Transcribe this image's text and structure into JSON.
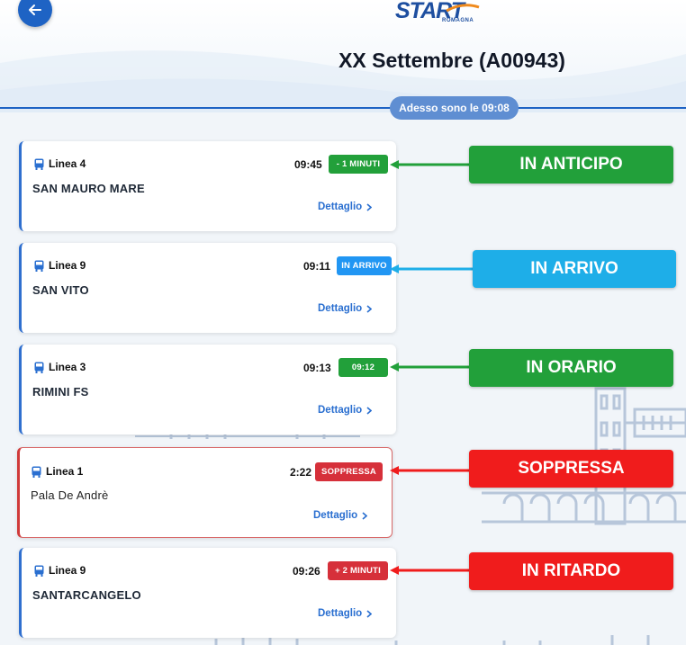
{
  "header": {
    "logo_text": "START",
    "logo_sub": "ROMAGNA",
    "title": "XX Settembre (A00943)",
    "now_label": "Adesso sono le 09:08"
  },
  "colors": {
    "early": "#22a03a",
    "arriving": "#2196f3",
    "cancelled": "#d6303a",
    "late": "#d6303a",
    "ontime": "#22a03a"
  },
  "departures": [
    {
      "line": "Linea 4",
      "destination": "SAN MAURO MARE",
      "time": "09:45",
      "badge": "- 1 MINUTI",
      "detail": "Dettaglio"
    },
    {
      "line": "Linea 9",
      "destination": "SAN VITO",
      "time": "09:11",
      "badge": "IN ARRIVO",
      "detail": "Dettaglio"
    },
    {
      "line": "Linea 3",
      "destination": "RIMINI FS",
      "time": "09:13",
      "badge": "09:12",
      "detail": "Dettaglio"
    },
    {
      "line": "Linea 1",
      "destination": "Pala De Andrè",
      "time": "2:22",
      "badge": "SOPPRESSA",
      "detail": "Dettaglio"
    },
    {
      "line": "Linea 9",
      "destination": "SANTARCANGELO",
      "time": "09:26",
      "badge": "+ 2 MINUTI",
      "detail": "Dettaglio"
    }
  ],
  "legend": [
    {
      "label": "IN ANTICIPO"
    },
    {
      "label": "IN ARRIVO"
    },
    {
      "label": "IN ORARIO"
    },
    {
      "label": "SOPPRESSA"
    },
    {
      "label": "IN RITARDO"
    }
  ]
}
